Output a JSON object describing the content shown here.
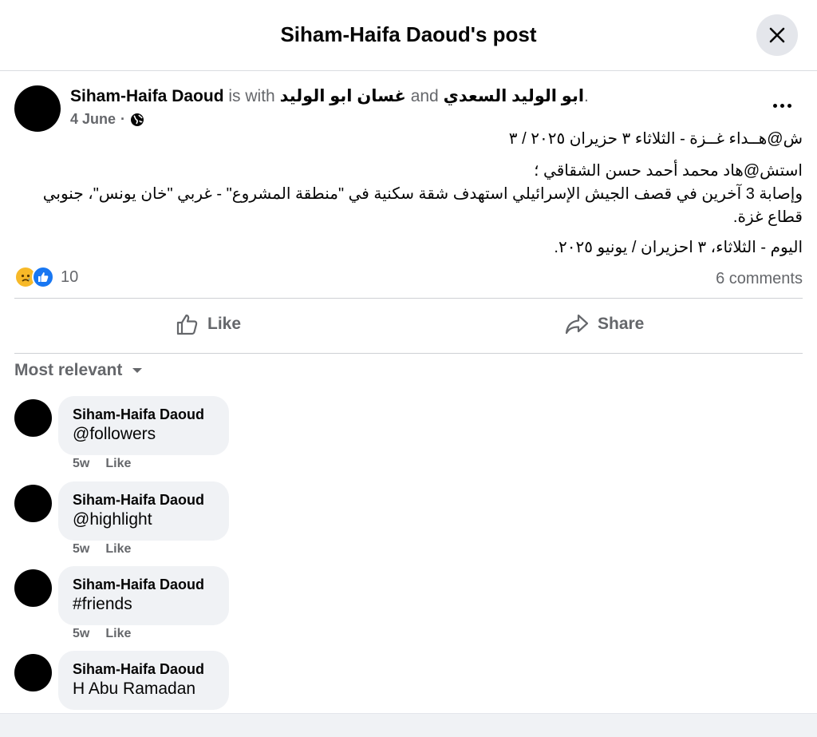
{
  "header": {
    "title": "Siham-Haifa Daoud's post"
  },
  "post": {
    "author": "Siham-Haifa Daoud",
    "with_text": "is with",
    "tagged_1": "غسان ابو الوليد",
    "and_text": "and",
    "tagged_2": "ابو الوليد السعدي",
    "headline_end": ".",
    "date": "4 June",
    "meta_sep": "·",
    "body_line1": "ش@هــداء غــزة - الثلاثاء ٣ حزيران ٢٠٢٥ / ٣",
    "body_line2": "استش@هاد  محمد أحمد حسن الشقاقي ؛",
    "body_line3": "وإصابة 3 آخرين في قصف الجيش الإسرائيلي  استهدف شقة سكنية في \"منطقة المشروع\" -  غربي \"خان يونس\"، جنوبي قطاع غزة.",
    "body_line4": "اليوم - الثلاثاء، ٣ احزيران / يونيو ٢٠٢٥."
  },
  "stats": {
    "reaction_count": "10",
    "comments": "6 comments"
  },
  "actions": {
    "like": "Like",
    "share": "Share"
  },
  "sort": {
    "label": "Most relevant"
  },
  "comments": [
    {
      "name": "Siham-Haifa Daoud",
      "text": "@followers",
      "time": "5w",
      "like": "Like"
    },
    {
      "name": "Siham-Haifa Daoud",
      "text": "@highlight",
      "time": "5w",
      "like": "Like"
    },
    {
      "name": "Siham-Haifa Daoud",
      "text": "#friends",
      "time": "5w",
      "like": "Like"
    },
    {
      "name": "Siham-Haifa Daoud",
      "text": "H Abu Ramadan",
      "time": "",
      "like": ""
    }
  ],
  "colors": {
    "accent": "#1877f2",
    "secondary_text": "#65676b",
    "bubble": "#f0f2f5"
  },
  "icons": [
    "close-icon",
    "globe-icon",
    "more-icon",
    "sad-reaction-icon",
    "like-reaction-icon",
    "thumbs-up-icon",
    "share-arrow-icon",
    "caret-down-icon"
  ]
}
